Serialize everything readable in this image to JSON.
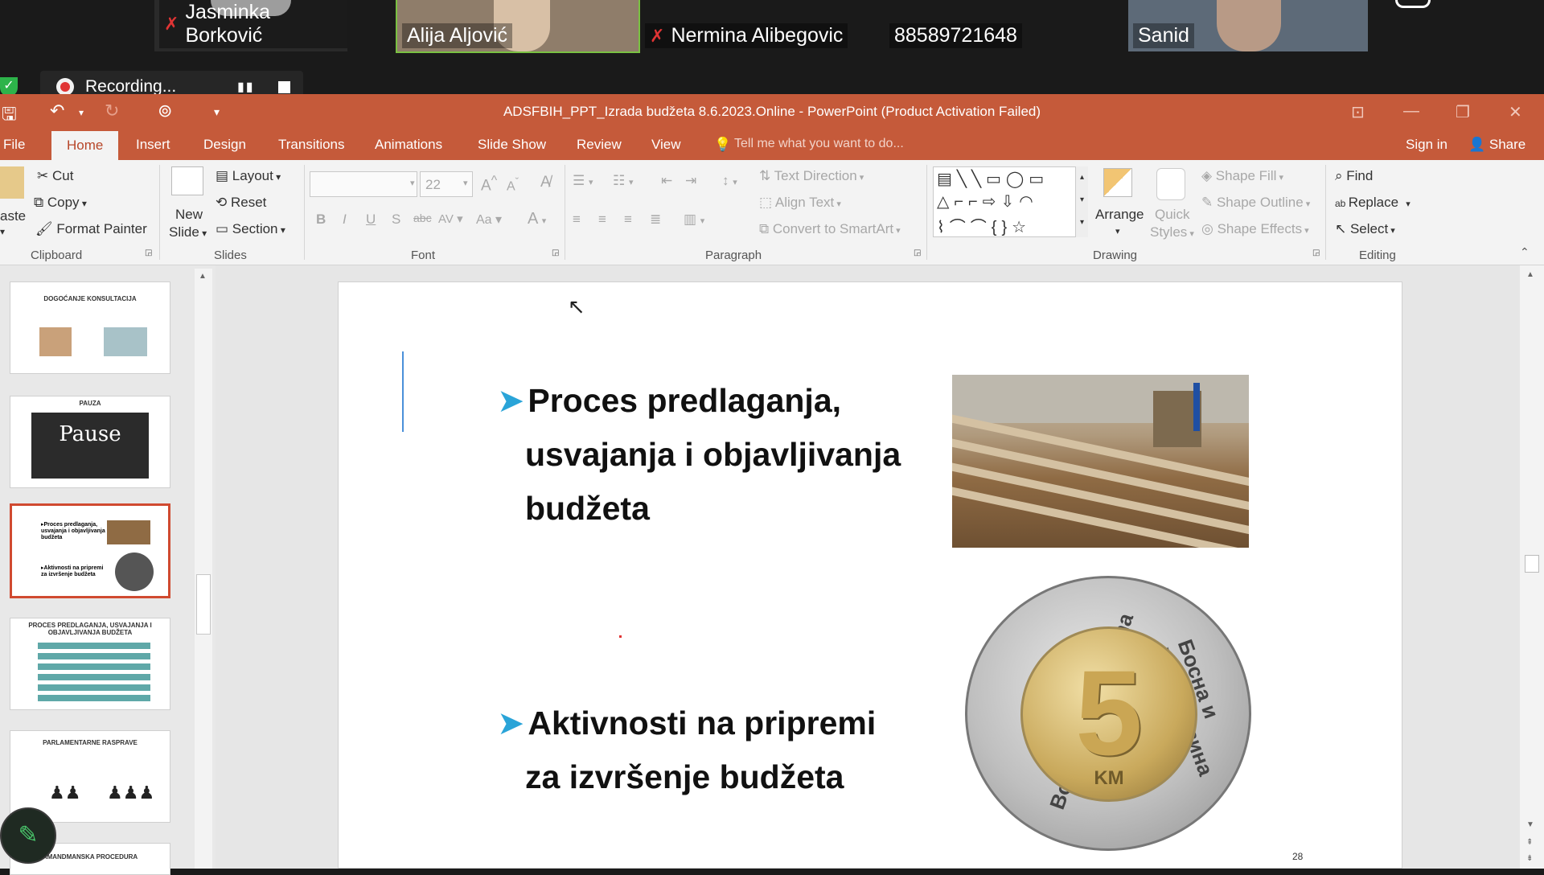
{
  "zoom": {
    "participants": [
      {
        "name": "Jasminka Borković",
        "muted": true
      },
      {
        "name": "Alija Aljović",
        "muted": false,
        "active": true
      },
      {
        "name": "Nermina Alibegovic",
        "muted": true
      },
      {
        "name": "88589721648",
        "muted": false
      },
      {
        "name": "Sanid",
        "muted": false
      }
    ],
    "recording_label": "Recording..."
  },
  "ppt": {
    "title": "ADSFBIH_PPT_Izrada budžeta 8.6.2023.Online - PowerPoint (Product Activation Failed)",
    "tabs": [
      "File",
      "Home",
      "Insert",
      "Design",
      "Transitions",
      "Animations",
      "Slide Show",
      "Review",
      "View"
    ],
    "tell_me": "Tell me what you want to do...",
    "sign_in": "Sign in",
    "share": "Share",
    "ribbon": {
      "clipboard": {
        "paste": "aste",
        "cut": "Cut",
        "copy": "Copy",
        "format_painter": "Format Painter",
        "label": "Clipboard"
      },
      "slides": {
        "new_slide_1": "New",
        "new_slide_2": "Slide",
        "layout": "Layout",
        "reset": "Reset",
        "section": "Section",
        "label": "Slides"
      },
      "font": {
        "size": "22",
        "bold": "B",
        "italic": "I",
        "underline": "U",
        "shadow": "S",
        "strike": "abc",
        "spacing": "AV",
        "case": "Aa",
        "label": "Font"
      },
      "paragraph": {
        "text_direction": "Text Direction",
        "align_text": "Align Text",
        "convert": "Convert to SmartArt",
        "label": "Paragraph"
      },
      "drawing": {
        "arrange": "Arrange",
        "quick_1": "Quick",
        "quick_2": "Styles",
        "shape_fill": "Shape Fill",
        "shape_outline": "Shape Outline",
        "shape_effects": "Shape Effects",
        "label": "Drawing"
      },
      "editing": {
        "find": "Find",
        "replace": "Replace",
        "select": "Select",
        "label": "Editing"
      }
    },
    "thumbnails": [
      {
        "caption": "DOGOĆANJE KONSULTACIJA"
      },
      {
        "caption": "PAUZA"
      },
      {
        "caption": ""
      },
      {
        "caption": "PROCES PREDLAGANJA, USVAJANJA I OBJAVLJIVANJA BUDŽETA"
      },
      {
        "caption": "PARLAMENTARNE RASPRAVE"
      },
      {
        "caption": "AMANDMANSKA PROCEDURA"
      }
    ],
    "thumb2_text": "Pause",
    "slide": {
      "bullet1": [
        "Proces predlaganja,",
        "usvajanja i objavljivanja",
        "budžeta"
      ],
      "bullet2": [
        "Aktivnosti na pripremi",
        "za izvršenje budžeta"
      ],
      "coin_value": "5",
      "coin_unit": "KM",
      "coin_left_text": "Bosna i Hercegovina",
      "coin_right_text": "Босна и Херцеговина",
      "page_number": "28"
    }
  }
}
